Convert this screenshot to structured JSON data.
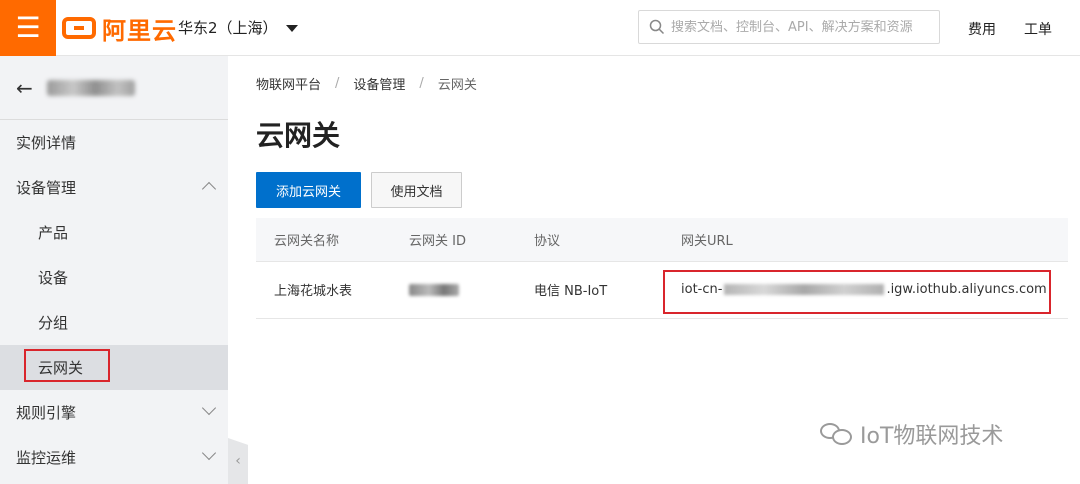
{
  "topbar": {
    "logo_text": "阿里云",
    "region": "华东2（上海）",
    "search_placeholder": "搜索文档、控制台、API、解决方案和资源",
    "links": [
      "费用",
      "工单"
    ],
    "accent_color": "#ff6a00"
  },
  "sidebar": {
    "items": [
      {
        "label": "实例详情"
      },
      {
        "label": "设备管理",
        "expanded": true
      },
      {
        "label": "产品"
      },
      {
        "label": "设备"
      },
      {
        "label": "分组"
      },
      {
        "label": "云网关",
        "selected": true
      },
      {
        "label": "规则引擎"
      },
      {
        "label": "监控运维"
      }
    ]
  },
  "main": {
    "breadcrumb": [
      "物联网平台",
      "设备管理",
      "云网关"
    ],
    "title": "云网关",
    "buttons": {
      "add": "添加云网关",
      "docs": "使用文档"
    },
    "table": {
      "headers": [
        "云网关名称",
        "云网关 ID",
        "协议",
        "网关URL"
      ],
      "rows": [
        {
          "name": "上海花城水表",
          "protocol": "电信 NB-IoT",
          "url_prefix": "iot-cn-",
          "url_suffix": ".igw.iothub.aliyuncs.com"
        }
      ]
    }
  },
  "watermark": "IoT物联网技术"
}
